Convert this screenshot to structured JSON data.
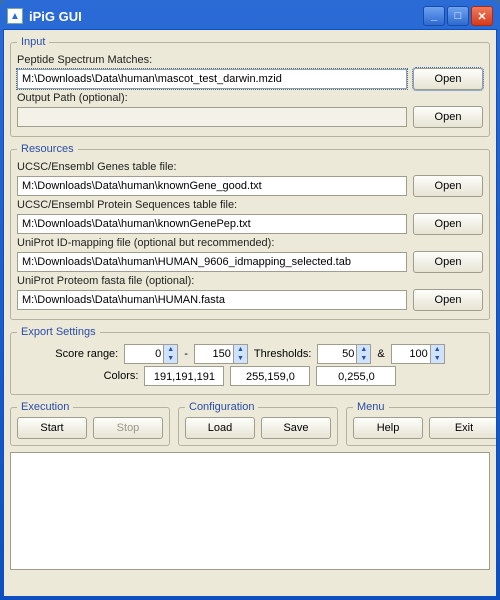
{
  "window": {
    "title": "iPiG GUI"
  },
  "input": {
    "legend": "Input",
    "psm_label": "Peptide Spectrum Matches:",
    "psm_value": "M:\\Downloads\\Data\\human\\mascot_test_darwin.mzid",
    "psm_open": "Open",
    "out_label": "Output Path (optional):",
    "out_value": "",
    "out_open": "Open"
  },
  "resources": {
    "legend": "Resources",
    "genes_label": "UCSC/Ensembl Genes table file:",
    "genes_value": "M:\\Downloads\\Data\\human\\knownGene_good.txt",
    "genes_open": "Open",
    "prot_label": "UCSC/Ensembl Protein Sequences table file:",
    "prot_value": "M:\\Downloads\\Data\\human\\knownGenePep.txt",
    "prot_open": "Open",
    "idmap_label": "UniProt ID-mapping file  (optional but recommended):",
    "idmap_value": "M:\\Downloads\\Data\\human\\HUMAN_9606_idmapping_selected.tab",
    "idmap_open": "Open",
    "fasta_label": "UniProt Proteom fasta file  (optional):",
    "fasta_value": "M:\\Downloads\\Data\\human\\HUMAN.fasta",
    "fasta_open": "Open"
  },
  "export": {
    "legend": "Export Settings",
    "score_label": "Score range:",
    "score_min": "0",
    "score_sep": "-",
    "score_max": "150",
    "thr_label": "Thresholds:",
    "thr1": "50",
    "thr_amp": "&",
    "thr2": "100",
    "colors_label": "Colors:",
    "c1": "191,191,191",
    "c2": "255,159,0",
    "c3": "0,255,0"
  },
  "execution": {
    "legend": "Execution",
    "start": "Start",
    "stop": "Stop"
  },
  "config": {
    "legend": "Configuration",
    "load": "Load",
    "save": "Save"
  },
  "menu": {
    "legend": "Menu",
    "help": "Help",
    "exit": "Exit"
  }
}
